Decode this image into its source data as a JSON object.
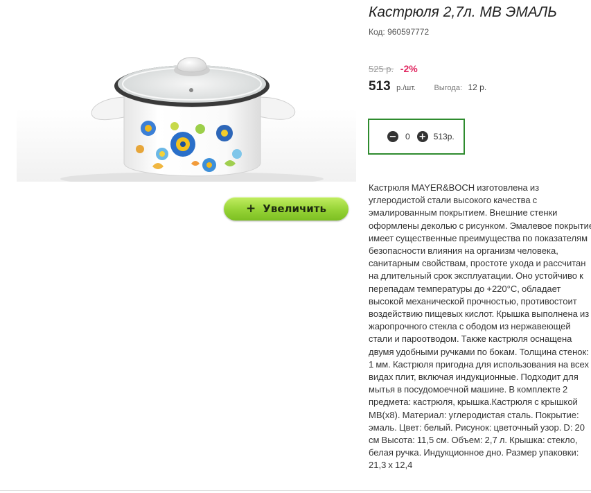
{
  "product": {
    "title": "Кастрюля 2,7л. МВ ЭМАЛЬ",
    "code": "Код: 960597772",
    "old_price": "525 р.",
    "discount": "-2%",
    "price": "513",
    "unit": "р./шт.",
    "benefit_label": "Выгода:",
    "benefit_value": "12 р.",
    "description": "Кастрюля MAYER&BOCH изготовлена из углеродистой стали высокого качества с эмалированным покрытием. Внешние стенки оформлены деколью с рисунком. Эмалевое покрытие имеет существенные преимущества по показателям безопасности влияния на организм человека, санитарным свойствам, простоте ухода и рассчитан на длительный срок эксплуатации. Оно устойчиво к перепадам температуры до +220°C, обладает высокой механической прочностью, противостоит воздействию пищевых кислот. Крышка выполнена из жаропрочного стекла с ободом из нержавеющей стали и пароотводом. Также кастрюля оснащена двумя удобными ручками по бокам. Толщина стенок: 1 мм. Кастрюля пригодна для использования на всех видах плит, включая индукционные. Подходит для мытья в посудомоечной машине. В комплекте 2 предмета: кастрюля, крышка.Кастрюля с крышкой МВ(х8). Материал: углеродистая сталь. Покрытие: эмаль. Цвет: белый. Рисунок: цветочный узор. D: 20 см Высота: 11,5 см. Объем: 2,7 л. Крышка: стекло, белая ручка. Индукционное дно. Размер упаковки: 21,3 х 12,4"
  },
  "quantity": {
    "minus_icon": "minus-circle-icon",
    "plus_icon": "plus-circle-icon",
    "minus_glyph": "−",
    "plus_glyph": "+",
    "value": "0",
    "total": "513р."
  },
  "zoom_button": {
    "icon": "plus-icon",
    "glyph": "+",
    "label": "Увеличить"
  },
  "colors": {
    "accent_green": "#96d336",
    "border_green": "#2e8b2e",
    "discount_red": "#e0245e"
  }
}
